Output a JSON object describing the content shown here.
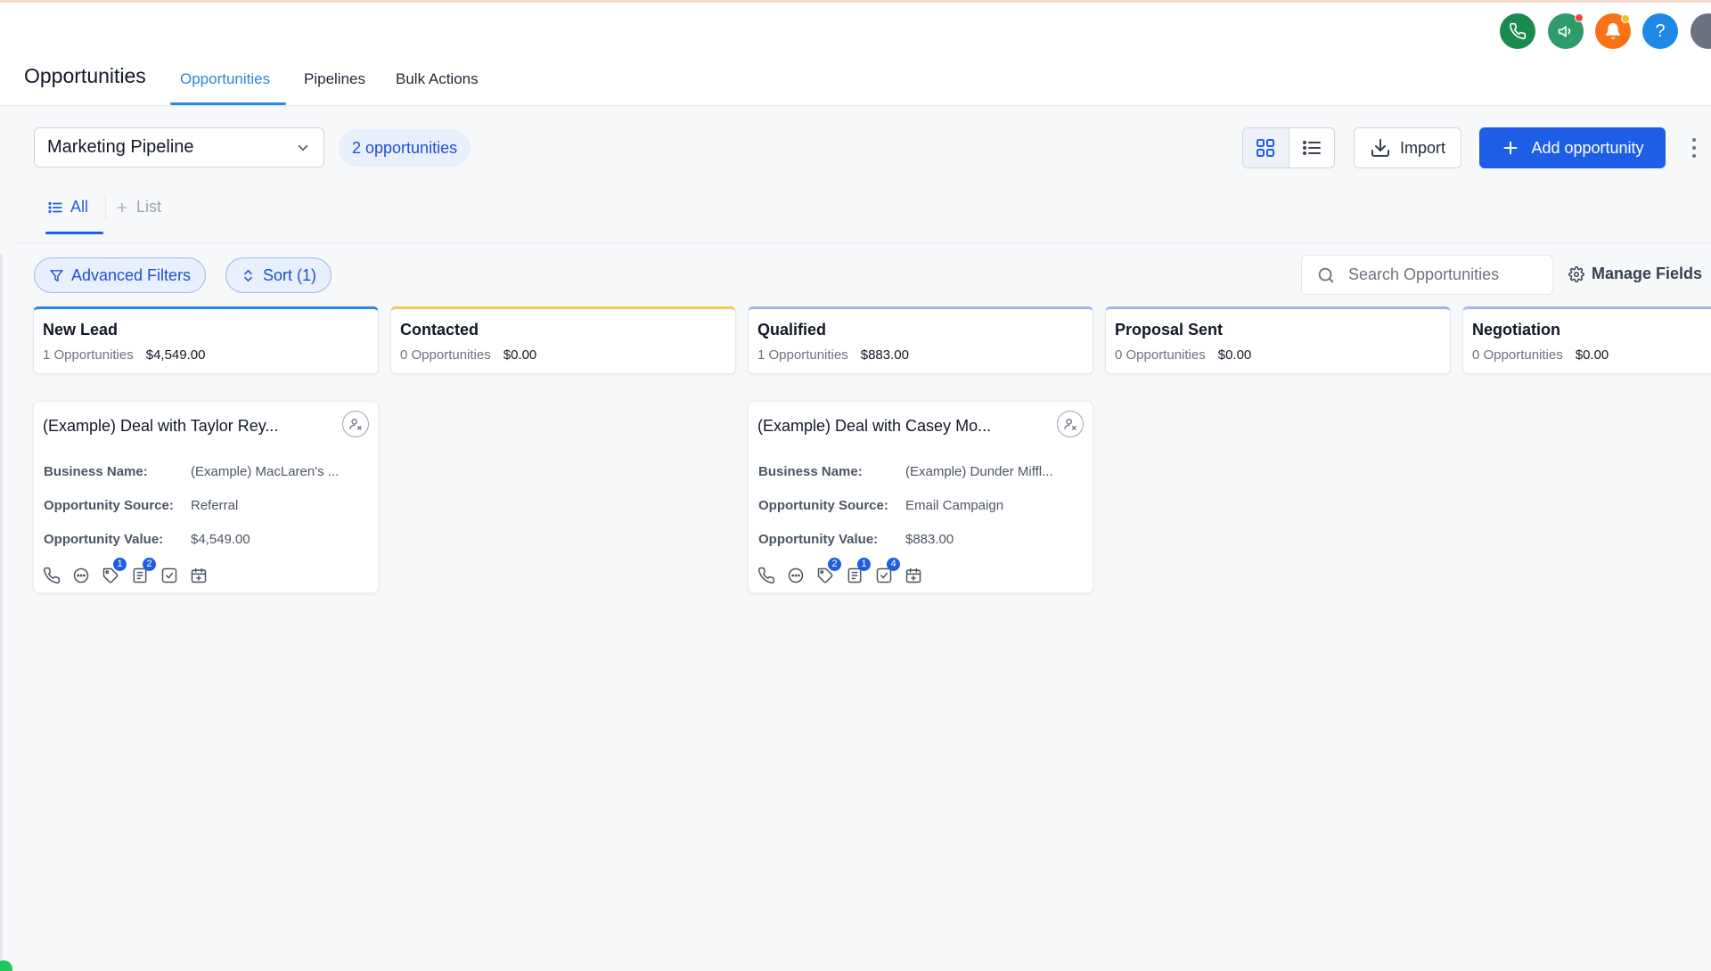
{
  "header": {
    "title": "Opportunities",
    "tabs": [
      {
        "label": "Opportunities",
        "active": true
      },
      {
        "label": "Pipelines",
        "active": false
      },
      {
        "label": "Bulk Actions",
        "active": false
      }
    ],
    "icons": [
      {
        "name": "phone-icon",
        "color": "#1a8a4e"
      },
      {
        "name": "megaphone-icon",
        "color": "#2f9a6a"
      },
      {
        "name": "bell-icon",
        "color": "#f97316"
      },
      {
        "name": "help-icon",
        "color": "#1e88e5",
        "glyph": "?"
      }
    ]
  },
  "toolbar": {
    "pipeline": "Marketing Pipeline",
    "count": "2 opportunities",
    "import_label": "Import",
    "add_label": "Add opportunity"
  },
  "lists": {
    "all_label": "All",
    "add_label": "List"
  },
  "filters": {
    "advanced_label": "Advanced Filters",
    "sort_label": "Sort (1)",
    "search_placeholder": "Search Opportunities",
    "manage_label": "Manage Fields"
  },
  "stages": [
    {
      "name": "New Lead",
      "count": "1 Opportunities",
      "amount": "$4,549.00",
      "color": "#2b87d8"
    },
    {
      "name": "Contacted",
      "count": "0 Opportunities",
      "amount": "$0.00",
      "color": "#f2c94c"
    },
    {
      "name": "Qualified",
      "count": "1 Opportunities",
      "amount": "$883.00",
      "color": "#a7b3f0"
    },
    {
      "name": "Proposal Sent",
      "count": "0 Opportunities",
      "amount": "$0.00",
      "color": "#a7b3f0"
    },
    {
      "name": "Negotiation",
      "count": "0 Opportunities",
      "amount": "$0.00",
      "color": "#a7b3f0"
    }
  ],
  "cards": [
    {
      "title": "(Example) Deal with Taylor Rey...",
      "business_label": "Business Name:",
      "business": "(Example) MacLaren's ...",
      "source_label": "Opportunity Source:",
      "source": "Referral",
      "value_label": "Opportunity Value:",
      "value": "$4,549.00",
      "badges": {
        "tag": "1",
        "notes": "2",
        "tasks": ""
      }
    },
    {
      "title": "(Example) Deal with Casey Mo...",
      "business_label": "Business Name:",
      "business": "(Example) Dunder Miffl...",
      "source_label": "Opportunity Source:",
      "source": "Email Campaign",
      "value_label": "Opportunity Value:",
      "value": "$883.00",
      "badges": {
        "tag": "2",
        "notes": "1",
        "tasks": "4"
      }
    }
  ]
}
